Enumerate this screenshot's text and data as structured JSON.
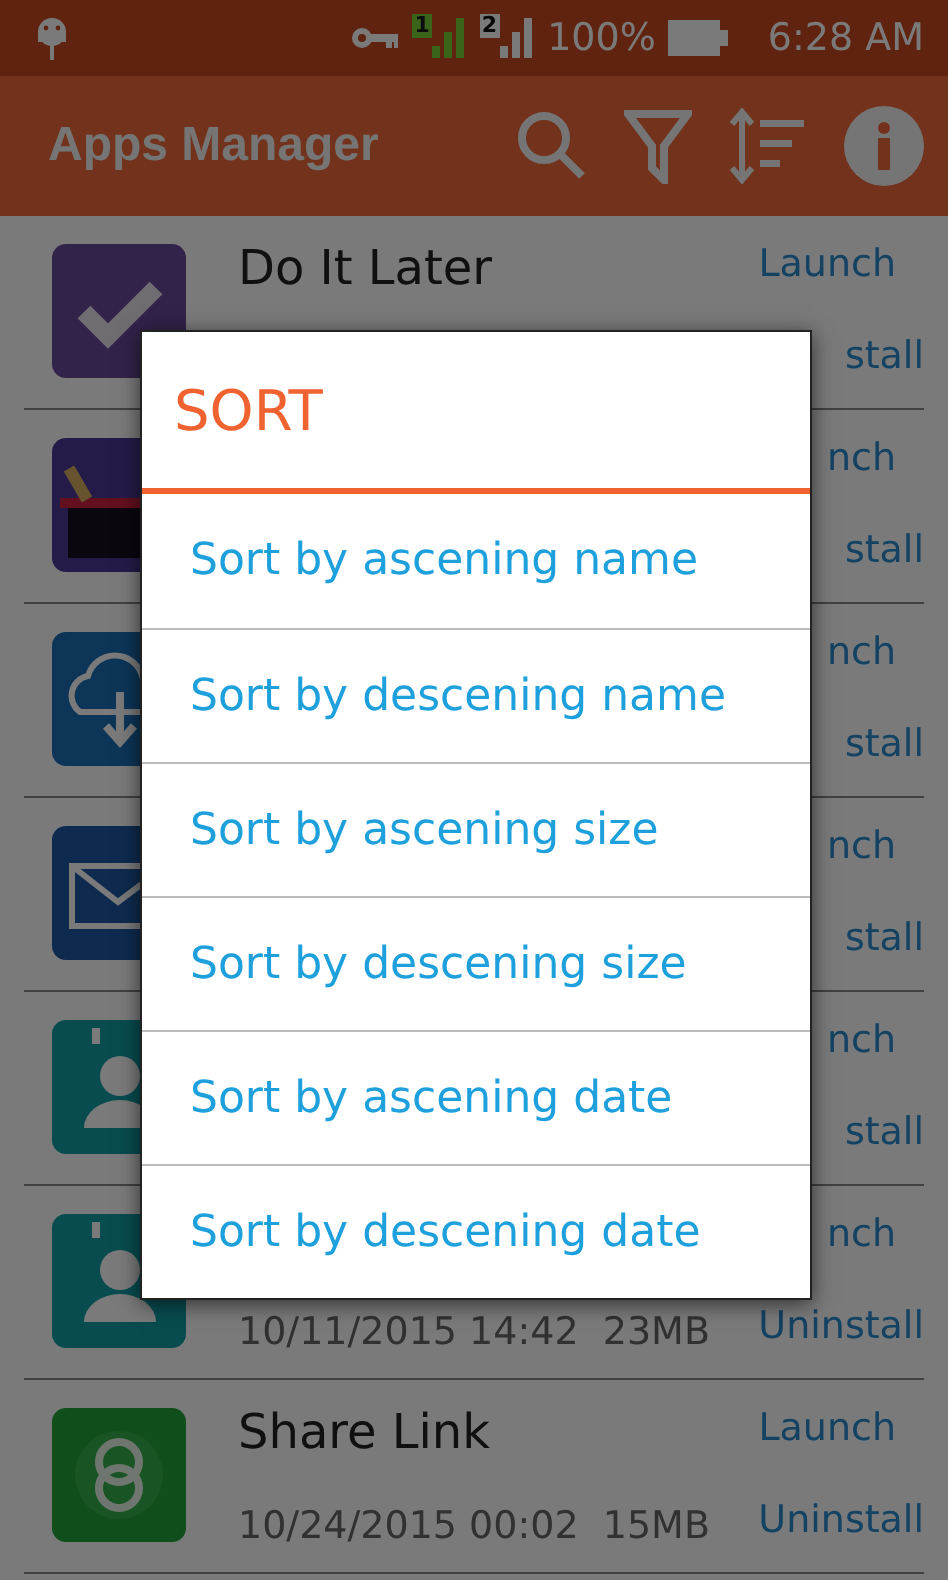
{
  "status_bar": {
    "sim_labels": [
      "1",
      "2"
    ],
    "battery": "100%",
    "time": "6:28 AM"
  },
  "app_bar": {
    "title": "Apps Manager"
  },
  "apps": [
    {
      "kind": "check",
      "name": "Do It Later",
      "launch": "Launch",
      "uninstall": "stall"
    },
    {
      "kind": "hat",
      "launch": "nch",
      "uninstall": "stall"
    },
    {
      "kind": "cloud",
      "launch": "nch",
      "uninstall": "stall"
    },
    {
      "kind": "mail",
      "launch": "nch",
      "uninstall": "stall"
    },
    {
      "kind": "contact",
      "launch": "nch",
      "uninstall": "stall"
    },
    {
      "kind": "contact",
      "details": "10/11/2015 14:42  23MB",
      "launch": "nch",
      "uninstall": "Uninstall"
    },
    {
      "kind": "rings",
      "name": "Share Link",
      "details": "10/24/2015 00:02  15MB",
      "launch": "Launch",
      "uninstall": "Uninstall"
    }
  ],
  "dialog": {
    "title": "SORT",
    "options": [
      "Sort by ascening name",
      "Sort by descening name",
      "Sort by ascening size",
      "Sort by descening size",
      "Sort by ascening date",
      "Sort by descening date"
    ]
  }
}
